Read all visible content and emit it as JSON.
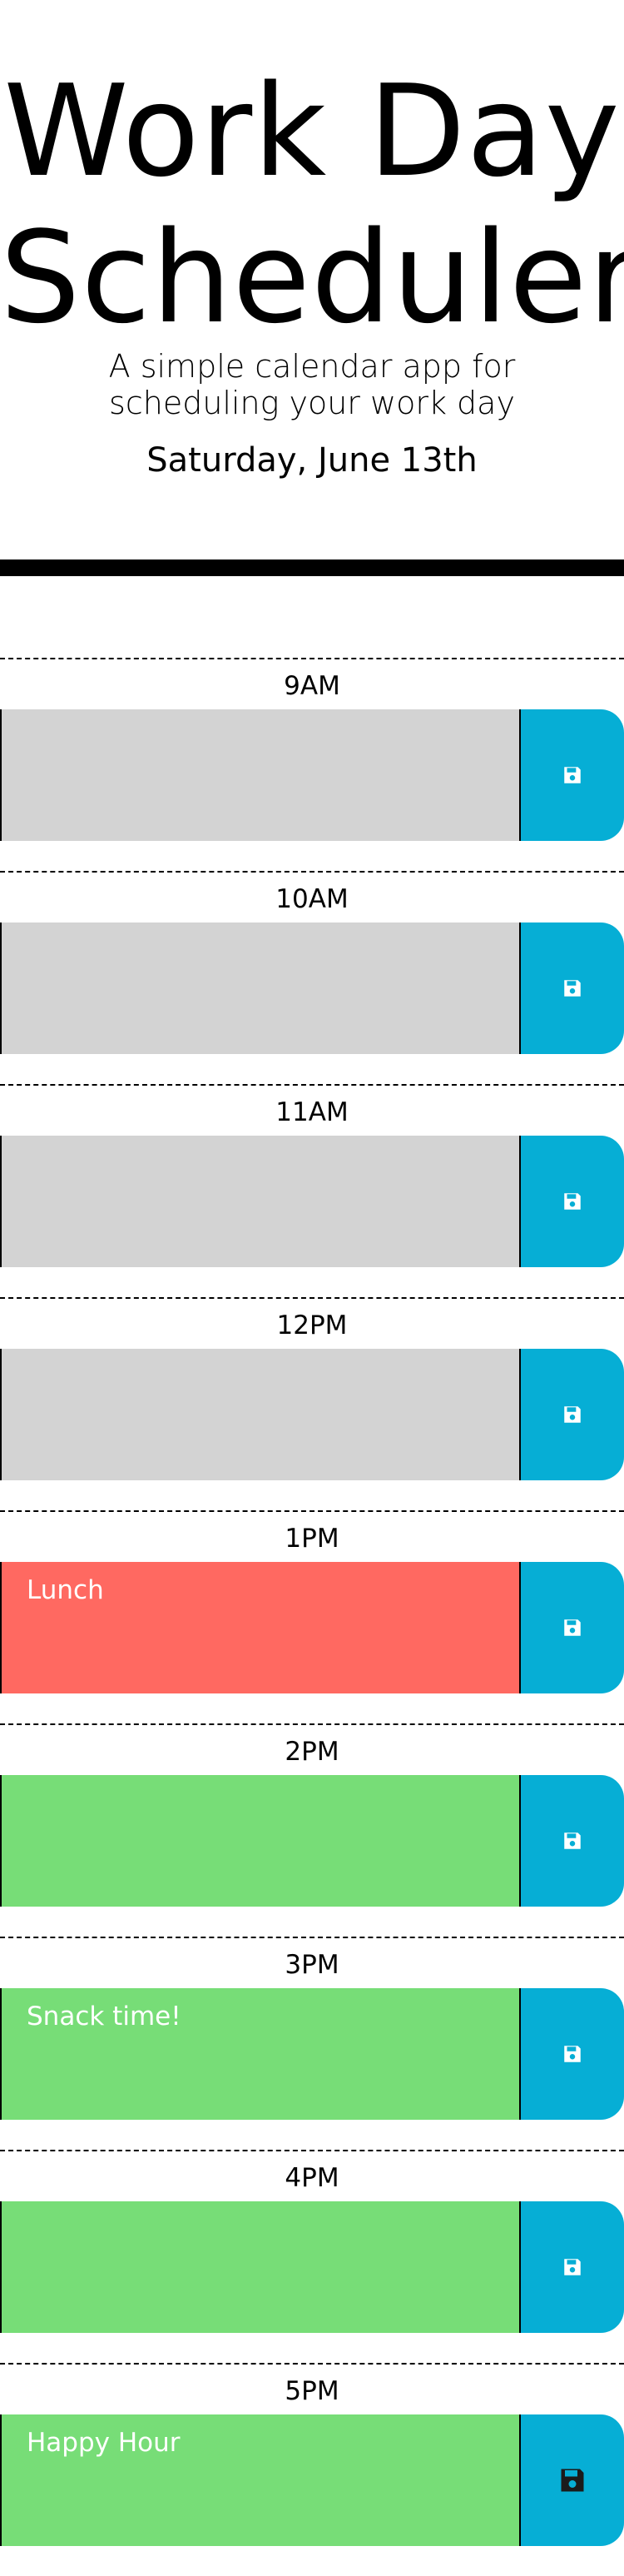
{
  "header": {
    "title_line1": "Work Day",
    "title_line2": "Scheduler",
    "subtitle_line1": "A simple calendar app for",
    "subtitle_line2": "scheduling your work day",
    "current_day": "Saturday, June 13th"
  },
  "colors": {
    "past": "#d3d3d3",
    "present": "#ff6961",
    "future": "#77dd77",
    "save_button": "#06aed5",
    "save_icon": "#ffffff",
    "save_icon_highlight": "#1b1b1b"
  },
  "save_icon_name": "floppy-disk-icon",
  "time_blocks": [
    {
      "hour": "9AM",
      "text": "",
      "state": "past"
    },
    {
      "hour": "10AM",
      "text": "",
      "state": "past"
    },
    {
      "hour": "11AM",
      "text": "",
      "state": "past"
    },
    {
      "hour": "12PM",
      "text": "",
      "state": "past"
    },
    {
      "hour": "1PM",
      "text": "Lunch",
      "state": "present"
    },
    {
      "hour": "2PM",
      "text": "",
      "state": "future"
    },
    {
      "hour": "3PM",
      "text": "Snack time!",
      "state": "future"
    },
    {
      "hour": "4PM",
      "text": "",
      "state": "future"
    },
    {
      "hour": "5PM",
      "text": "Happy Hour",
      "state": "future",
      "icon_highlight": true
    }
  ]
}
